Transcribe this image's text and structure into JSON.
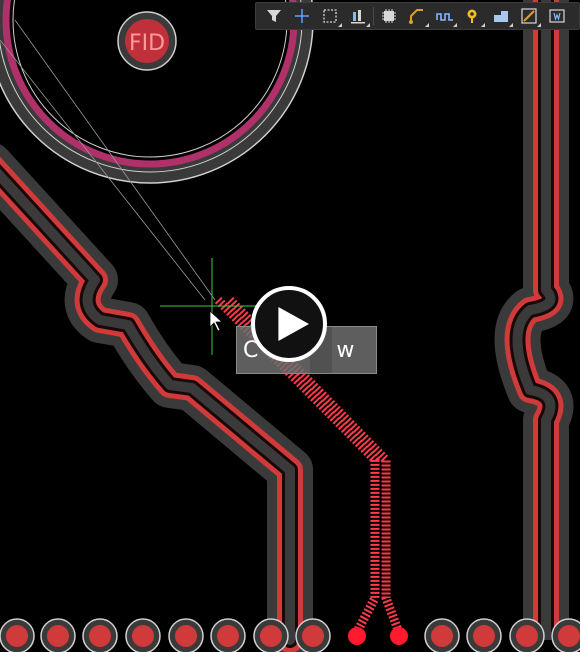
{
  "board": {
    "fiducial_label": "FID",
    "colors": {
      "background": "#000000",
      "clearance": "#3a3a3a",
      "track_red": "#d03a3a",
      "track_center": "#5a1818",
      "outline_white": "#c8c8c8",
      "ring_magenta": "#b0306a",
      "pad_selected": "#ff1a2e",
      "crosshair_green": "#3ccb3c"
    }
  },
  "hint_overlay": {
    "left_text": "C",
    "right_text": "w"
  },
  "toolbar": {
    "buttons": [
      {
        "icon": "filter-icon"
      },
      {
        "icon": "crosshair-add-icon"
      },
      {
        "icon": "select-rect-icon"
      },
      {
        "icon": "align-icon"
      },
      {
        "icon": "component-icon"
      },
      {
        "icon": "route-track-icon"
      },
      {
        "icon": "interactive-length-tuning-icon"
      },
      {
        "icon": "via-icon"
      },
      {
        "icon": "fill-region-icon"
      },
      {
        "icon": "route-diff-pair-icon"
      },
      {
        "icon": "text-string-icon"
      }
    ]
  }
}
